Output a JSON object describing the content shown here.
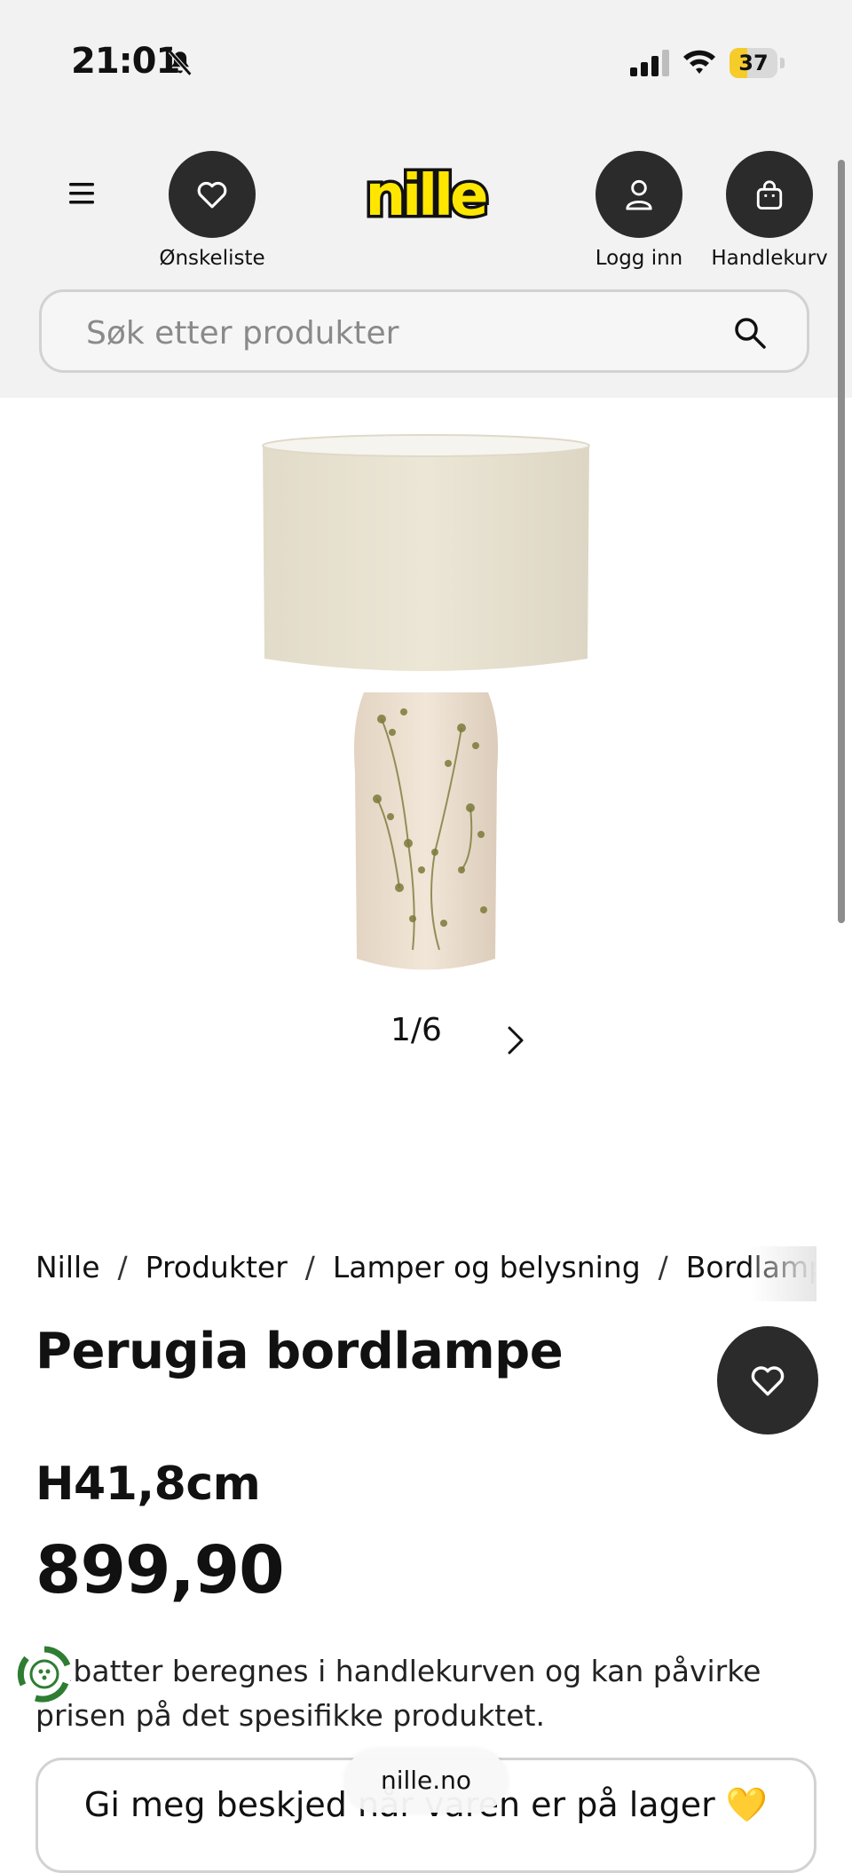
{
  "status_bar": {
    "time": "21:01",
    "battery": "37",
    "battery_level": 0.37
  },
  "header": {
    "wishlist_label": "Ønskeliste",
    "login_label": "Logg inn",
    "cart_label": "Handlekurv",
    "logo_text": "nille"
  },
  "search": {
    "placeholder": "Søk etter produkter"
  },
  "gallery": {
    "current": "1",
    "total": "6",
    "counter": "1/6"
  },
  "breadcrumb": [
    "Nille",
    "Produkter",
    "Lamper og belysning",
    "Bordlamper"
  ],
  "product": {
    "title": "Perugia bordlampe",
    "height": "H41,8cm",
    "price": "899,90",
    "note": "Rabatter beregnes i handlekurven og kan påvirke prisen på det spesifikke produktet."
  },
  "notify_button": {
    "label": "Gi meg beskjed når varen er på lager 💛"
  },
  "browser": {
    "url": "nille.no"
  },
  "colors": {
    "dark_button": "#2b2b2b",
    "header_bg": "#f2f2f2",
    "brand_yellow": "#ffe600"
  }
}
